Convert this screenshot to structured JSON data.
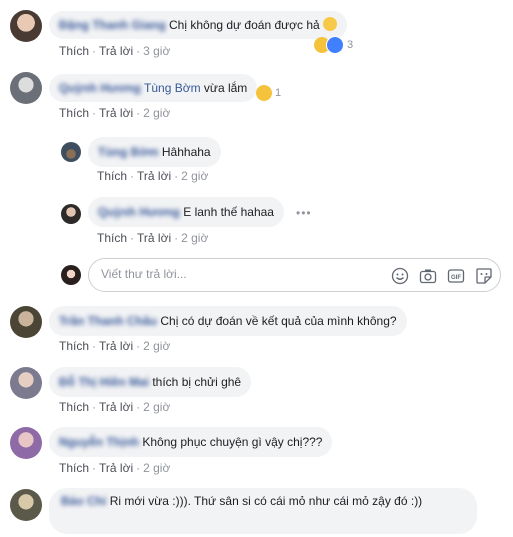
{
  "comments": [
    {
      "author": "Đặng Thanh Giang",
      "text": "Chị không dự đoán được hả",
      "like": "Thích",
      "reply": "Trả lời",
      "time": "3 giờ",
      "reaction_count": "3"
    },
    {
      "author": "Quỳnh Hương",
      "mention": "Tùng Bờm",
      "text": "vừa lắm",
      "like": "Thích",
      "reply": "Trả lời",
      "time": "2 giờ",
      "reaction_count": "1"
    },
    {
      "author": "Tùng Bờm",
      "text": "Hâhhaha",
      "like": "Thích",
      "reply": "Trả lời",
      "time": "2 giờ"
    },
    {
      "author": "Quỳnh Hương",
      "text": "E lanh thế hahaa",
      "like": "Thích",
      "reply": "Trả lời",
      "time": "2 giờ"
    },
    {
      "author": "Trần Thanh Châu",
      "text": "Chị có dự đoán về kết quả của mình không?",
      "like": "Thích",
      "reply": "Trả lời",
      "time": "2 giờ"
    },
    {
      "author": "Đỗ Thị Hiền Mai",
      "text": "thích bị chửi ghê",
      "like": "Thích",
      "reply": "Trả lời",
      "time": "2 giờ"
    },
    {
      "author": "Nguyễn Thịnh",
      "text": "Không phục chuyện gì vậy chị???",
      "like": "Thích",
      "reply": "Trả lời",
      "time": "2 giờ"
    },
    {
      "author": "Bảo Chi",
      "text": "Ri mới vừa :))). Thứ sân si có cái mỏ như cái mỏ       zậy đó :))"
    }
  ],
  "reply_box": {
    "placeholder": "Viết thư trả lời..."
  },
  "more_glyph": "•••",
  "icons": {
    "emoji": "smiley-icon",
    "camera": "camera-icon",
    "gif": "gif-icon",
    "sticker": "sticker-icon",
    "haha": "haha-reaction-icon",
    "like": "like-reaction-icon",
    "sad": "sad-reaction-icon"
  },
  "colors": {
    "author": "#385898",
    "bubble": "#f2f3f5",
    "meta": "#90949c",
    "like": "#4080ff"
  }
}
